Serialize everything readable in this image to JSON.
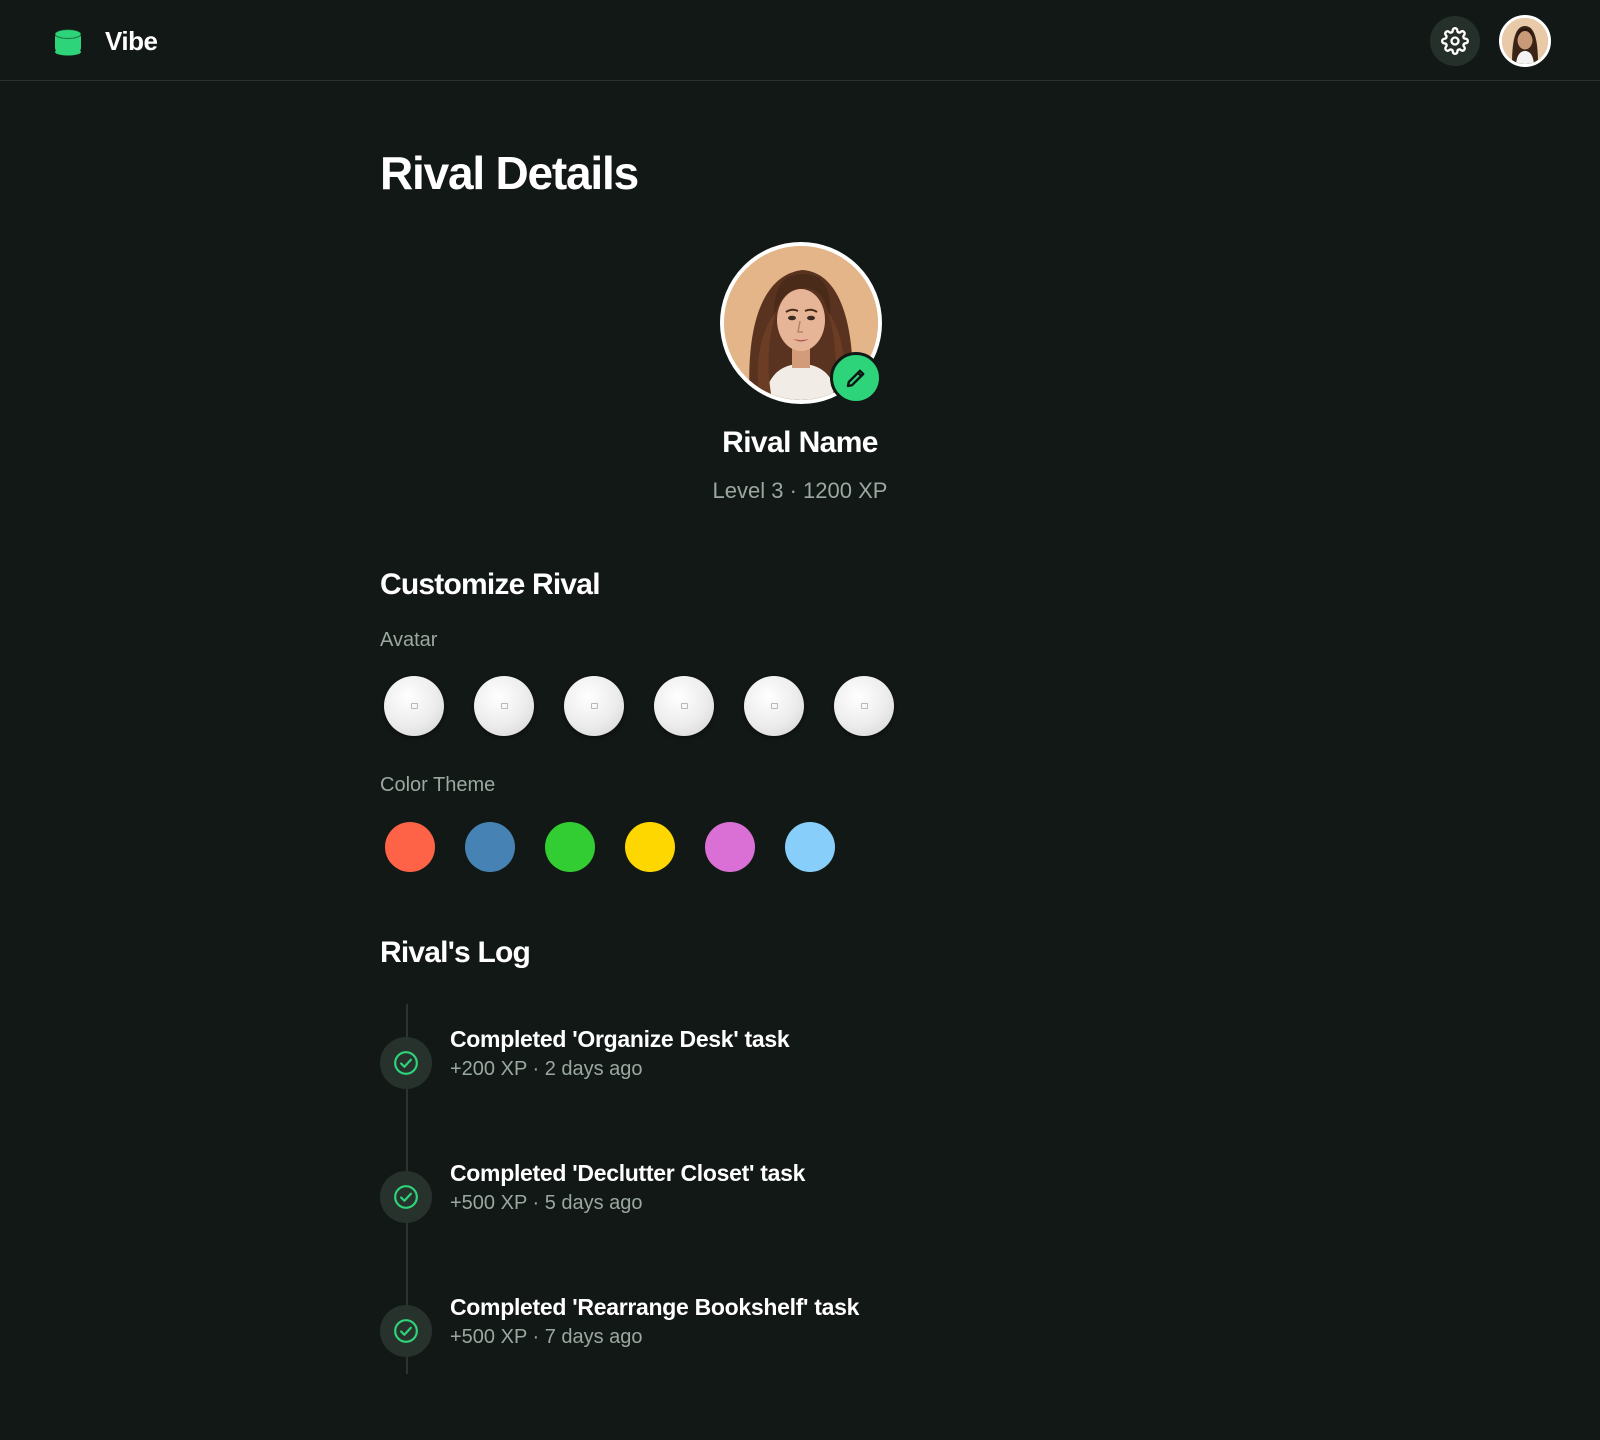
{
  "app": {
    "name": "Vibe",
    "brand_icon": "database-cylinder-icon",
    "accent": "#2ed47a"
  },
  "header": {
    "settings_icon": "gear-icon",
    "user_avatar": "user-avatar"
  },
  "page": {
    "title": "Rival Details"
  },
  "profile": {
    "name": "Rival Name",
    "meta": "Level 3 · 1200 XP",
    "edit_icon": "pencil-icon"
  },
  "customize": {
    "title": "Customize Rival",
    "avatar_label": "Avatar",
    "avatar_options": [
      "avatar-option-1",
      "avatar-option-2",
      "avatar-option-3",
      "avatar-option-4",
      "avatar-option-5",
      "avatar-option-6"
    ],
    "color_label": "Color Theme",
    "colors": [
      "#ff6347",
      "#4682b4",
      "#32cd32",
      "#ffd700",
      "#da70d6",
      "#87cefa"
    ]
  },
  "log": {
    "title": "Rival's Log",
    "items": [
      {
        "title": "Completed 'Organize Desk' task",
        "meta": "+200 XP · 2 days ago"
      },
      {
        "title": "Completed 'Declutter Closet' task",
        "meta": "+500 XP · 5 days ago"
      },
      {
        "title": "Completed 'Rearrange Bookshelf' task",
        "meta": "+500 XP · 7 days ago"
      }
    ]
  }
}
